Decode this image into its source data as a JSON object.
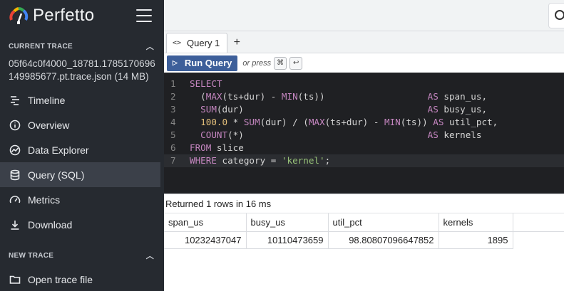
{
  "app": {
    "name": "Perfetto"
  },
  "sidebar": {
    "current_trace_heading": "CURRENT TRACE",
    "trace_file": "05f64c0f4000_18781.1785170696149985677.pt.trace.json (14 MB)",
    "items": [
      {
        "label": "Timeline",
        "icon": "timeline-icon"
      },
      {
        "label": "Overview",
        "icon": "info-icon"
      },
      {
        "label": "Data Explorer",
        "icon": "explore-icon"
      },
      {
        "label": "Query (SQL)",
        "icon": "database-icon",
        "active": true
      },
      {
        "label": "Metrics",
        "icon": "speed-icon"
      },
      {
        "label": "Download",
        "icon": "download-icon"
      }
    ],
    "new_trace_heading": "NEW TRACE",
    "new_trace_items": [
      {
        "label": "Open trace file",
        "icon": "folder-icon"
      }
    ]
  },
  "query_page": {
    "tab_label": "Query 1",
    "tab_icon": "code-icon",
    "add_tab_label": "+",
    "run_label": "Run Query",
    "hint": "or press",
    "kbd_cmd": "⌘",
    "kbd_enter": "↩",
    "code_lines": [
      {
        "n": "1",
        "t": "SELECT"
      },
      {
        "n": "2",
        "t": "  (MAX(ts+dur) - MIN(ts))                   AS span_us,"
      },
      {
        "n": "3",
        "t": "  SUM(dur)                                  AS busy_us,"
      },
      {
        "n": "4",
        "t": "  100.0 * SUM(dur) / (MAX(ts+dur) - MIN(ts)) AS util_pct,"
      },
      {
        "n": "5",
        "t": "  COUNT(*)                                  AS kernels"
      },
      {
        "n": "6",
        "t": "FROM slice"
      },
      {
        "n": "7",
        "t": "WHERE category = 'kernel';"
      }
    ],
    "result_summary": "Returned 1 rows in 16 ms",
    "columns": [
      "span_us",
      "busy_us",
      "util_pct",
      "kernels"
    ],
    "rows": [
      [
        "10232437047",
        "10110473659",
        "98.80807096647852",
        "1895"
      ]
    ]
  },
  "colors": {
    "sidebar_bg": "#262a30",
    "run_button": "#3d5f9a",
    "editor_bg": "#1f2023",
    "keyword": "#c586c0",
    "number": "#e5c07b",
    "string": "#98c379"
  }
}
